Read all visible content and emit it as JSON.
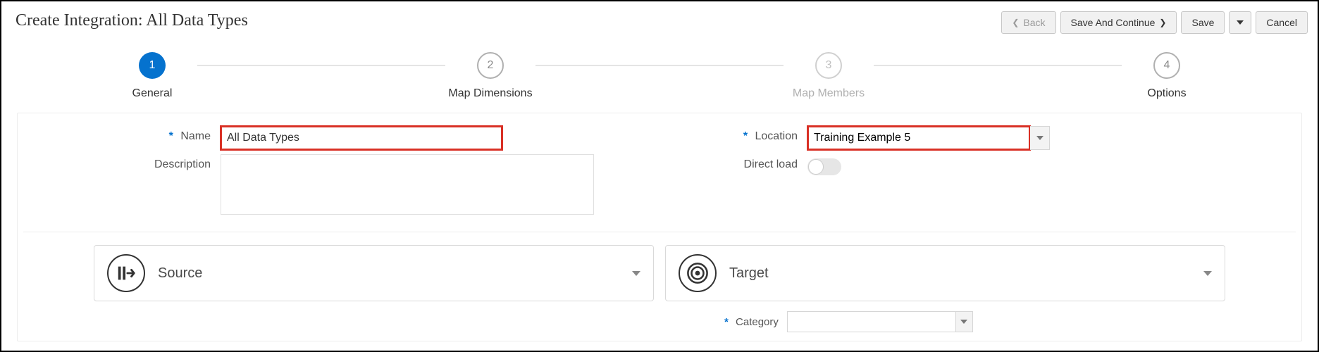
{
  "pageTitle": "Create Integration: All Data Types",
  "buttons": {
    "back": "Back",
    "saveContinue": "Save And Continue",
    "save": "Save",
    "cancel": "Cancel"
  },
  "steps": {
    "s1": {
      "num": "1",
      "label": "General"
    },
    "s2": {
      "num": "2",
      "label": "Map Dimensions"
    },
    "s3": {
      "num": "3",
      "label": "Map Members"
    },
    "s4": {
      "num": "4",
      "label": "Options"
    }
  },
  "fields": {
    "nameLabel": "Name",
    "nameValue": "All Data Types",
    "descLabel": "Description",
    "descValue": "",
    "locationLabel": "Location",
    "locationValue": "Training Example 5",
    "directLoadLabel": "Direct load",
    "categoryLabel": "Category",
    "categoryValue": ""
  },
  "cards": {
    "source": "Source",
    "target": "Target"
  },
  "req": "*"
}
